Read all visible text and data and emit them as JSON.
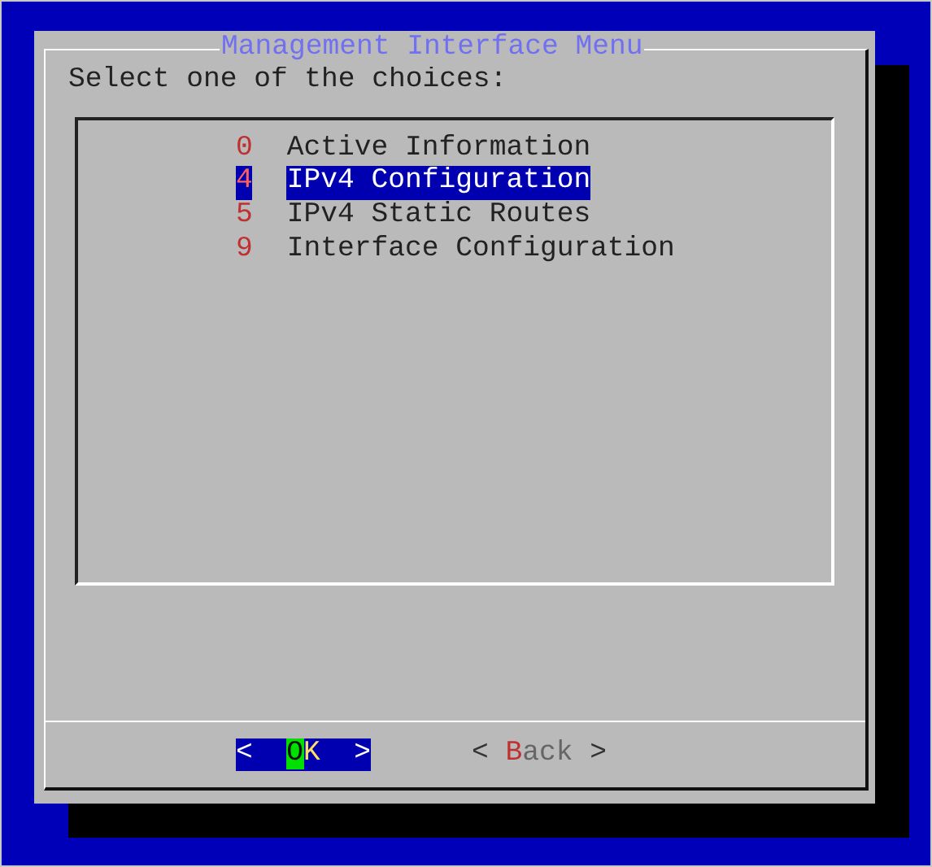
{
  "dialog": {
    "title": "Management Interface Menu",
    "prompt": "Select one of the choices:"
  },
  "menu_items": [
    {
      "tag": "0",
      "label": "Active Information",
      "selected": false
    },
    {
      "tag": "4",
      "label": "IPv4 Configuration",
      "selected": true
    },
    {
      "tag": "5",
      "label": "IPv4 Static Routes",
      "selected": false
    },
    {
      "tag": "9",
      "label": "Interface Configuration",
      "selected": false
    }
  ],
  "buttons": [
    {
      "open": "<",
      "hotkey": "O",
      "rest": "K",
      "close": ">",
      "selected": true
    },
    {
      "open": "<",
      "hotkey": "B",
      "rest": "ack",
      "close": ">",
      "selected": false
    }
  ]
}
